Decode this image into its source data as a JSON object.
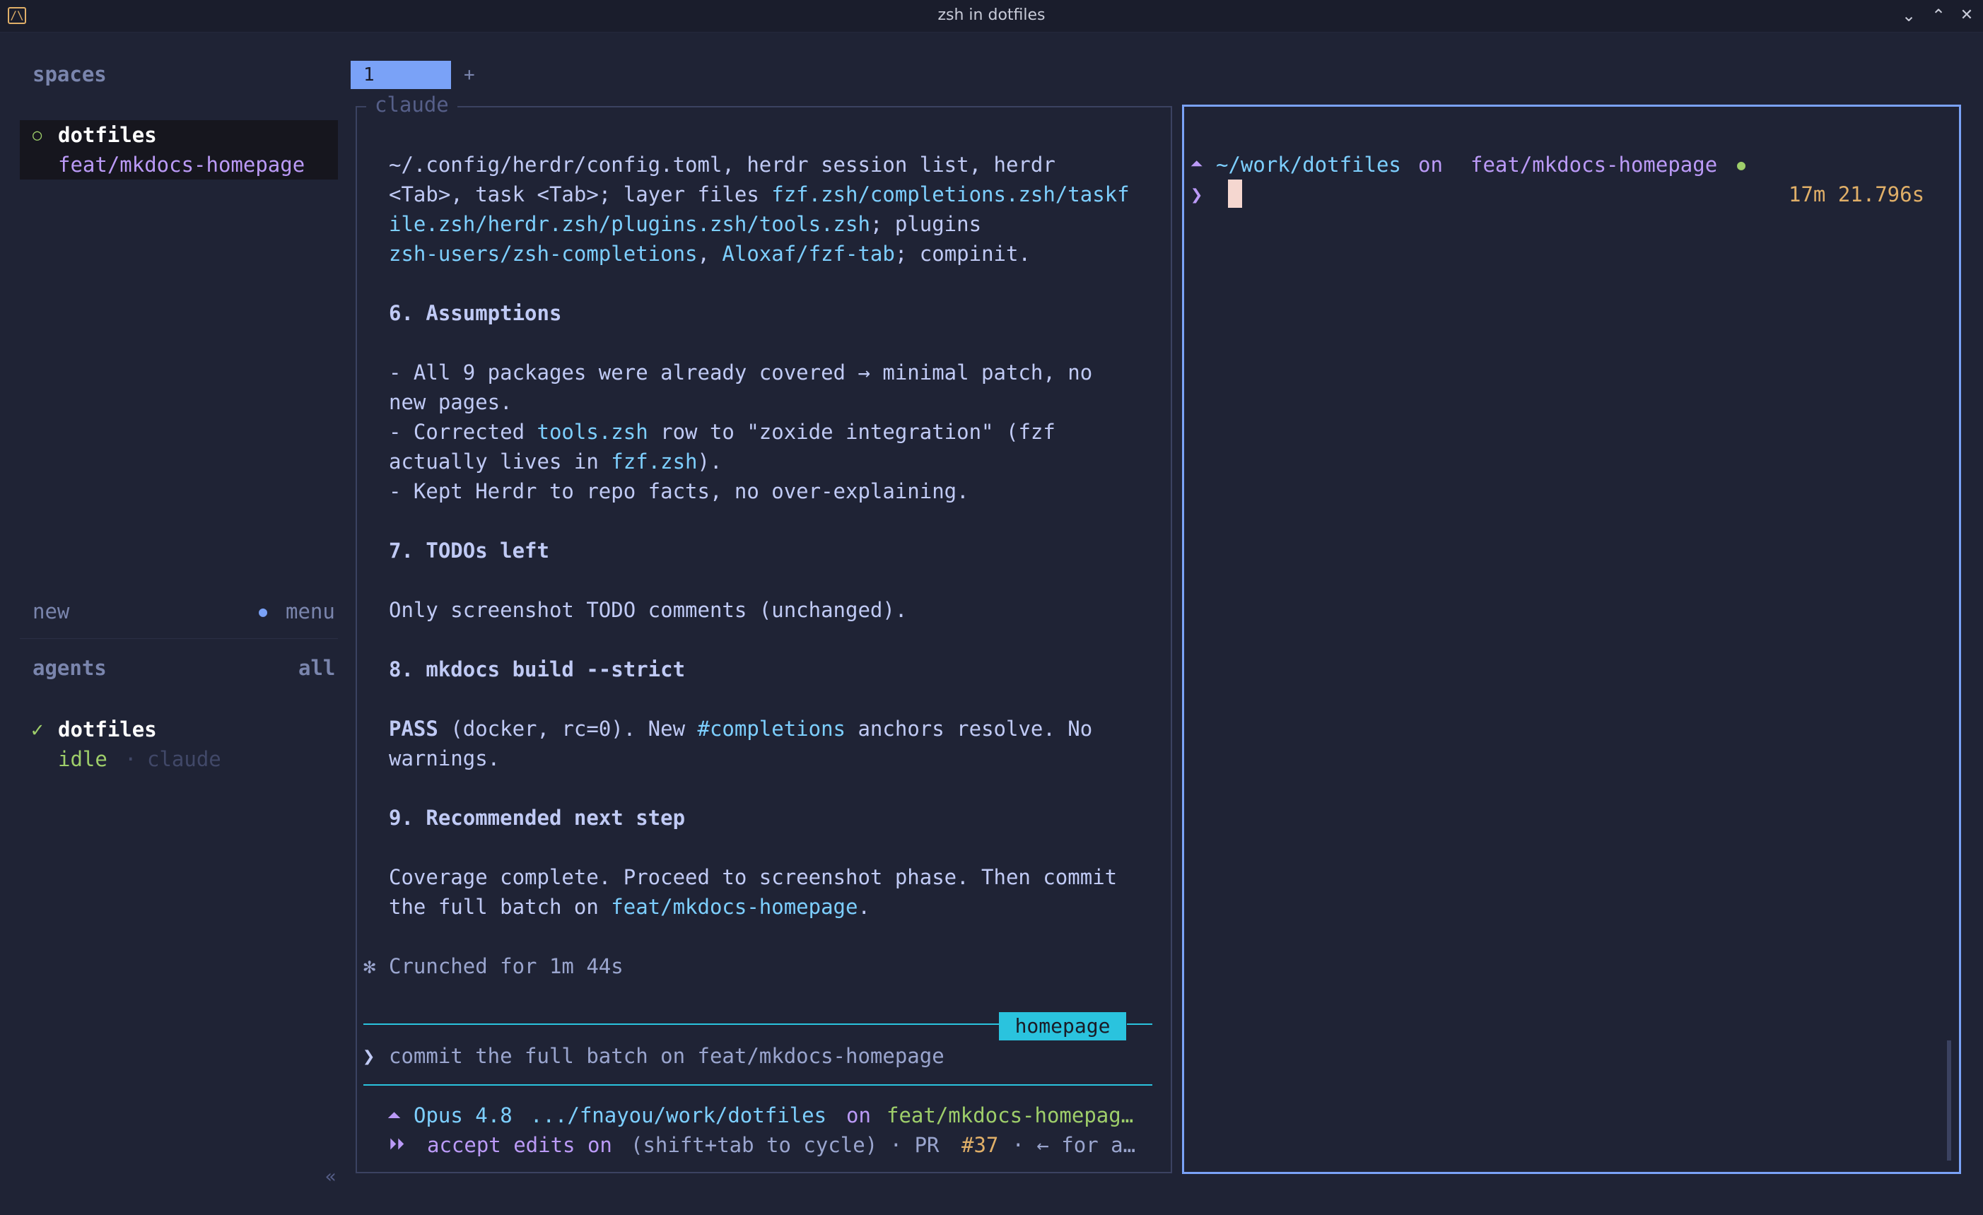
{
  "window": {
    "title": "zsh in dotfiles",
    "app_icon_glyph": "/\\",
    "minimize_glyph": "⌄",
    "maximize_glyph": "⌃",
    "close_glyph": "✕"
  },
  "sidebar": {
    "spaces_heading": "spaces",
    "space": {
      "bullet": "○",
      "name": "dotfiles",
      "branch": "feat/mkdocs-homepage"
    },
    "new_label": "new",
    "menu_dot": "●",
    "menu_label": "menu",
    "agents_heading": "agents",
    "agents_all": "all",
    "agent": {
      "check": "✓",
      "name": "dotfiles",
      "status": "idle",
      "separator": "·",
      "tool": "claude"
    },
    "collapse_glyph": "«"
  },
  "tabs": {
    "active_label": "1",
    "add_label": "+"
  },
  "left_pane": {
    "label": "claude",
    "lines": {
      "l1": "~/.config/herdr/config.toml, herdr session list, herdr",
      "l2a": "<Tab>, task <Tab>; layer files ",
      "l2b": "fzf.zsh/completions.zsh/taskf",
      "l3a": "ile.zsh/herdr.zsh/plugins.zsh/tools.zsh",
      "l3b": "; plugins",
      "l4a": "zsh-users/zsh-completions",
      "l4b": ", ",
      "l4c": "Aloxaf/fzf-tab",
      "l4d": "; compinit.",
      "h6": "6. Assumptions",
      "a1": "- All 9 packages were already covered → minimal patch, no",
      "a2": "new pages.",
      "a3a": "- Corrected ",
      "a3b": "tools.zsh",
      "a3c": " row to \"zoxide integration\" (fzf",
      "a4a": "actually lives in ",
      "a4b": "fzf.zsh",
      "a4c": ").",
      "a5": "- Kept Herdr to repo facts, no over-explaining.",
      "h7": "7. TODOs left",
      "t1": "Only screenshot TODO comments (unchanged).",
      "h8": "8. mkdocs build --strict",
      "p1a": "PASS",
      "p1b": " (docker, rc=0). New ",
      "p1c": "#completions",
      "p1d": " anchors resolve. No",
      "p2": "warnings.",
      "h9": "9. Recommended next step",
      "r1": "Coverage complete. Proceed to screenshot phase. Then commit",
      "r2a": "the full batch on ",
      "r2b": "feat/mkdocs-homepage",
      "r2c": ".",
      "crunch_glyph": "✻",
      "crunch": "Crunched for 1m 44s"
    },
    "badge": "homepage",
    "prompt_glyph": "❯",
    "input_text": "commit the full batch on feat/mkdocs-homepage",
    "status": {
      "glyph1": "⏶",
      "model": "Opus 4.8",
      "path": ".../fnayou/work/dotfiles",
      "on": "on",
      "branch": "feat/mkdocs-homepag…",
      "glyph2": "⏵⏵",
      "mode": "accept edits on",
      "hint": "(shift+tab to cycle) · PR ",
      "pr": "#37",
      "rest": " · ← for a…"
    }
  },
  "right_pane": {
    "prompt_glyph1": "⏶",
    "path": "~/work/dotfiles",
    "on": "on",
    "branch": "feat/mkdocs-homepage",
    "branch_glyph": "",
    "dirty_dot": "●",
    "prompt_glyph2": "❯",
    "elapsed": "17m 21.796s"
  },
  "colors": {
    "accent": "#7aa2f7",
    "cyan": "#2ac3de",
    "branch_purple": "#bb9af7",
    "green": "#9ece6a",
    "yellow": "#e0af68"
  }
}
